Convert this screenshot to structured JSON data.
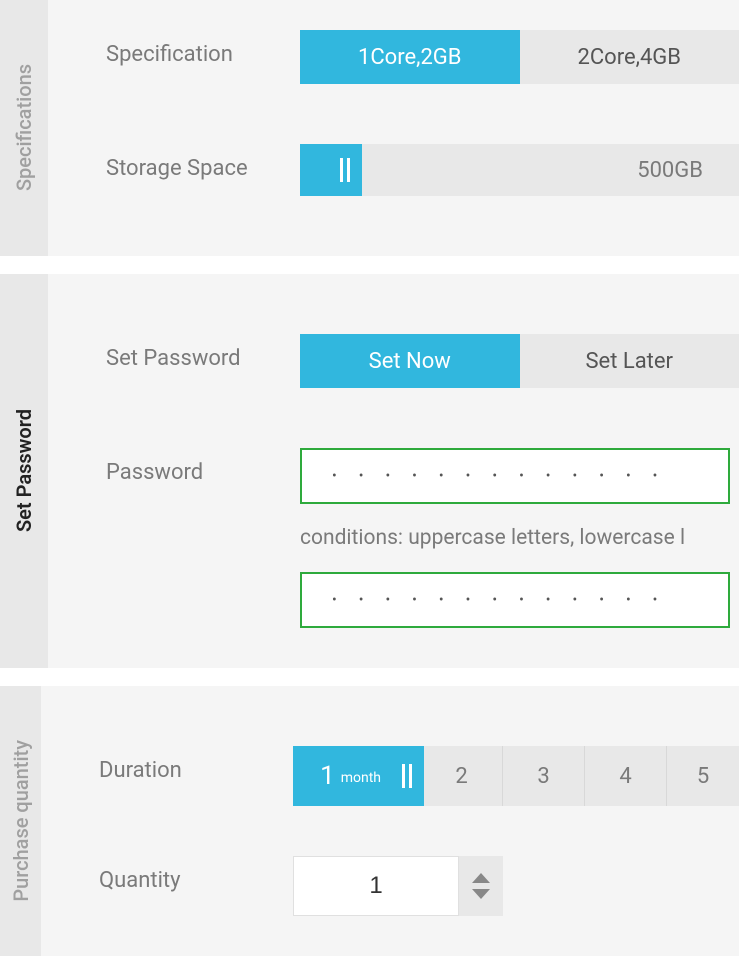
{
  "specifications": {
    "section_label": "Specifications",
    "spec_label": "Specification",
    "spec_options": [
      "1Core,2GB",
      "2Core,4GB"
    ],
    "storage_label": "Storage Space",
    "storage_value": "500GB"
  },
  "password": {
    "section_label": "Set Password",
    "set_label": "Set Password",
    "set_options": [
      "Set Now",
      "Set Later"
    ],
    "password_label": "Password",
    "hint": "conditions: uppercase letters, lowercase l",
    "dots": "•••••••••••••"
  },
  "purchase": {
    "section_label": "Purchase quantity",
    "duration_label": "Duration",
    "duration_selected": "1",
    "duration_unit": "month",
    "duration_options": [
      "2",
      "3",
      "4",
      "5"
    ],
    "quantity_label": "Quantity",
    "quantity_value": "1"
  }
}
